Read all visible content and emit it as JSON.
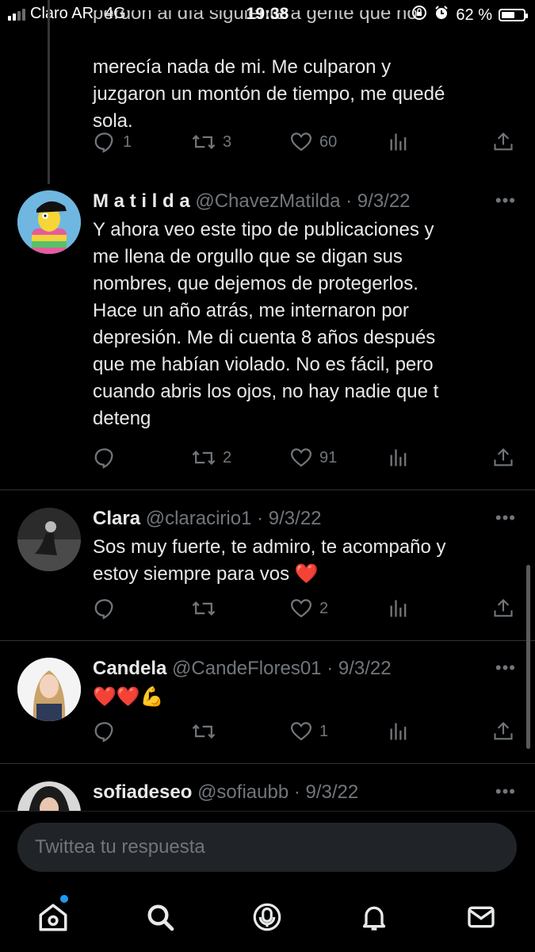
{
  "status_bar": {
    "carrier": "Claro AR",
    "network": "4G",
    "time": "19:38",
    "battery": "62 %",
    "battery_level": 0.62
  },
  "tweets": [
    {
      "text": "merecía nada de mi. Me culparon y\njuzgaron un montón de tiempo, me quedé\nsola.",
      "replies": "1",
      "retweets": "3",
      "likes": "60"
    },
    {
      "name": "M a t i l d a",
      "handle": "@ChavezMatilda",
      "date": "· 9/3/22",
      "text": "Y ahora veo este tipo de publicaciones y\nme llena de orgullo que se digan sus\nnombres, que dejemos de protegerlos.\nHace un año atrás, me internaron por\ndepresión. Me di cuenta 8 años después\nque me habían violado. No es fácil, pero\ncuando abris los ojos, no hay nadie que t\ndeteng",
      "replies": "",
      "retweets": "2",
      "likes": "91"
    },
    {
      "name": "Clara",
      "handle": "@claracirio1",
      "date": "· 9/3/22",
      "text": "Sos muy fuerte, te admiro, te acompaño y\nestoy siempre para vos ❤️",
      "replies": "",
      "retweets": "",
      "likes": "2"
    },
    {
      "name": "Candela",
      "handle": "@CandeFlores01",
      "date": "· 9/3/22",
      "text": "❤️❤️💪",
      "replies": "",
      "retweets": "",
      "likes": "1"
    },
    {
      "name": "sofiadeseo",
      "handle": "@sofiaubb",
      "date": "· 9/3/22"
    }
  ],
  "reply_box": {
    "placeholder": "Twittea tu respuesta"
  },
  "tab_bar": [
    "home-icon",
    "search-icon",
    "spaces-icon",
    "notifications-icon",
    "messages-icon"
  ],
  "colors": {
    "background": "#000000",
    "text": "#e7e9ea",
    "muted": "#71767b",
    "accent": "#1d9bf0",
    "divider": "#2f3336"
  }
}
